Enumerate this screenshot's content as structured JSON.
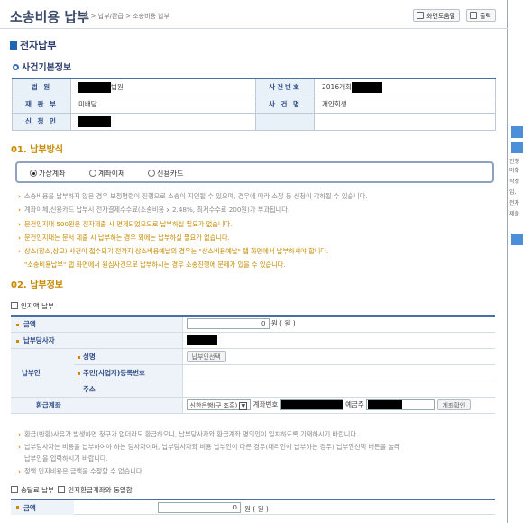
{
  "header": {
    "title": "소송비용 납부",
    "breadcrumb": "홈 > 납부/환급 > 소송비용 납부",
    "help_button": "화면도움말",
    "print_button": "출력"
  },
  "section_main": "전자납부",
  "case_info": {
    "heading": "사건기본정보",
    "court_label": "법 원",
    "court_value_suffix": "법원",
    "case_no_label": "사건번호",
    "case_no_value": "2016개회",
    "division_label": "재 판 부",
    "division_value": "미배당",
    "case_name_label": "사 건 명",
    "case_name_value": "개인회생",
    "applicant_label": "신 청 인"
  },
  "payment_method": {
    "heading": "01. 납부방식",
    "options": [
      "가상계좌",
      "계좌이체",
      "신용카드"
    ],
    "selected": "가상계좌"
  },
  "notes1": [
    "소송비용을 납부하지 않은 경우 보정명령이 진행으로 소송이 지연될 수 있으며, 경우에 따라 소장 등 신청이 각하될 수 있습니다.",
    "계좌이체,신용카드 납부시 전자결제수수료(소송비용 x 2.48%, 최저수수료 200원)가 부과됩니다.",
    "문건인지대 500원은 전자제출 시 면제되었으므로 납부하실 필요가 없습니다.",
    "문건인지대는 문서 제출 시 납부하는 경우 외에는 납부하실 필요가 없습니다.",
    "상소(항소,상고) 사건이 접수되기 전까지 상소비용예납의 경우는 \"상소비용예납\" 탭 화면에서 납부하셔야 합니다.",
    "\"소송비용납부\" 탭 화면에서 원심사건으로 납부하시는 경우 소송진행에 문제가 있을 수 있습니다."
  ],
  "payment_info": {
    "heading": "02. 납부정보",
    "stamp_only_label": "인지액 납부",
    "amount_label": "금액",
    "amount_value": "0",
    "won": "원 ( 원 )",
    "payer_label": "납부당사자",
    "payer_group_label": "납부인",
    "name_label": "성명",
    "payer_select_button": "납부인선택",
    "id_label": "주민(사업자)등록번호",
    "address_label": "주소",
    "refund_label": "환급계좌",
    "bank_value": "신한은행(구 조흥)",
    "account_label": "계좌번호",
    "holder_label": "예금주",
    "confirm_button": "계좌확인"
  },
  "notes2": [
    "환급(반환)사유가 발생하면 청구가 없더라도 환급하오니, 납부당사자와 환급계좌 명의인이 일치하도록 기재하시기 바랍니다.",
    "납부당사자는 비용을 납부하여야 하는 당사자이며, 납부당사자와 비용 납부인이 다른 경우(대리인이 납부하는 경우) 납부인선택 버튼을 눌러",
    "납부인을 입력하시기 바랍니다.",
    "정액 인지비용은 금액을 수정할 수 없습니다."
  ],
  "delivery": {
    "delivery_label": "송달료 납부",
    "agree_label": "인지환급계좌와 동일함",
    "amount_label": "금액",
    "amount_value": "0",
    "won": "원 ( 원 )"
  },
  "sidebar_text": [
    "진행",
    "미확",
    "작성",
    "입,",
    "전자",
    "제출"
  ]
}
